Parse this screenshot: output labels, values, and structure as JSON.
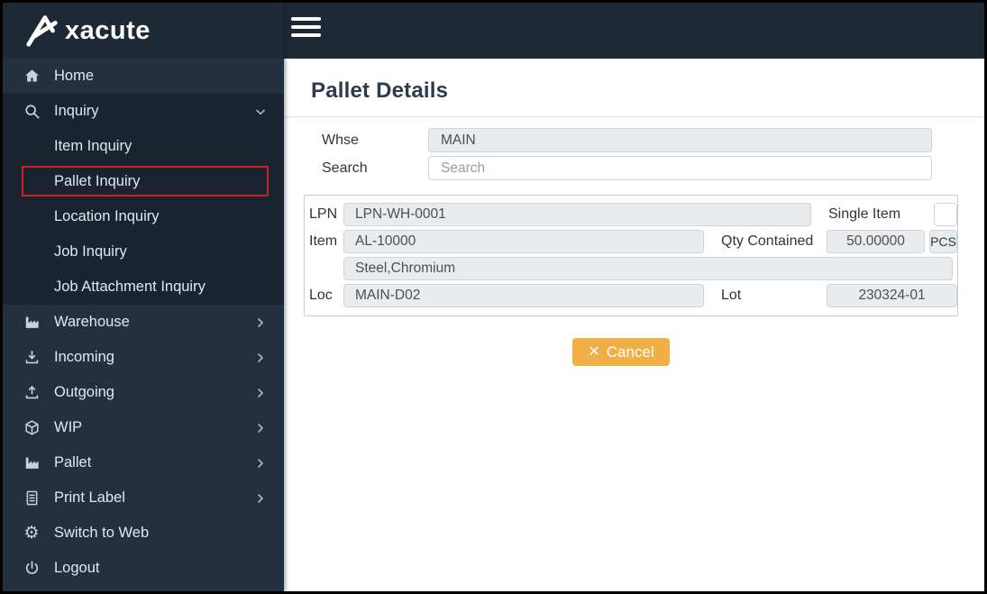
{
  "brand": {
    "logo_text": "xacute"
  },
  "sidebar": {
    "items": [
      {
        "label": "Home",
        "icon": "home-icon"
      },
      {
        "label": "Inquiry",
        "icon": "search-icon",
        "chevron": "down",
        "expanded": true
      },
      {
        "label": "Item Inquiry",
        "sub": true
      },
      {
        "label": "Pallet Inquiry",
        "sub": true,
        "annotated": true
      },
      {
        "label": "Location Inquiry",
        "sub": true
      },
      {
        "label": "Job Inquiry",
        "sub": true
      },
      {
        "label": "Job Attachment Inquiry",
        "sub": true
      },
      {
        "label": "Warehouse",
        "icon": "factory-icon",
        "chevron": "right"
      },
      {
        "label": "Incoming",
        "icon": "download-icon",
        "chevron": "right"
      },
      {
        "label": "Outgoing",
        "icon": "upload-icon",
        "chevron": "right"
      },
      {
        "label": "WIP",
        "icon": "cube-icon",
        "chevron": "right"
      },
      {
        "label": "Pallet",
        "icon": "factory-icon",
        "chevron": "right"
      },
      {
        "label": "Print Label",
        "icon": "document-icon",
        "chevron": "right"
      },
      {
        "label": "Switch to Web",
        "icon": "gear-icon"
      },
      {
        "label": "Logout",
        "icon": "power-icon"
      }
    ]
  },
  "main": {
    "title": "Pallet Details",
    "form": {
      "whse_label": "Whse",
      "whse_value": "MAIN",
      "search_label": "Search",
      "search_placeholder": "Search"
    },
    "panel": {
      "lpn_label": "LPN",
      "lpn_value": "LPN-WH-0001",
      "single_item_label": "Single Item",
      "single_item_checked": false,
      "item_label": "Item",
      "item_value": "AL-10000",
      "qty_label": "Qty Contained",
      "qty_value": "50.00000",
      "uom": "PCS",
      "description_value": "Steel,Chromium",
      "loc_label": "Loc",
      "loc_value": "MAIN-D02",
      "lot_label": "Lot",
      "lot_value": "230324-01"
    },
    "cancel_icon": "✕",
    "cancel_label": "Cancel"
  },
  "colors": {
    "topbar": "#1e2936",
    "sidebar": "#233040",
    "sidebar_group": "#1a2431",
    "annotation_red": "#c42424",
    "button_orange": "#f0b046",
    "input_disabled_bg": "#e9ecef",
    "input_border": "#ced4da"
  }
}
